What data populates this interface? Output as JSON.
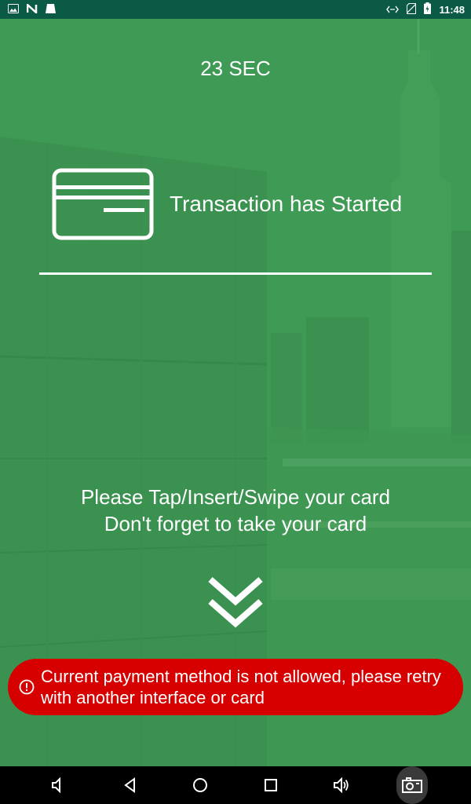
{
  "status_bar": {
    "time": "11:48",
    "left_icons": [
      "image-icon",
      "n-app-icon",
      "notification-icon"
    ],
    "right_icons": [
      "data-sync-icon",
      "no-sim-icon",
      "battery-charging-icon"
    ]
  },
  "screen": {
    "timer": "23 SEC",
    "transaction_title": "Transaction has Started",
    "instruction_line1": "Please Tap/Insert/Swipe your card",
    "instruction_line2": "Don't forget to take your card",
    "error_message": "Current payment method is not allowed, please retry with another interface or card",
    "colors": {
      "background_green": "#3f9a55",
      "status_bar": "#0b5a45",
      "error_red": "#d60000"
    }
  },
  "nav_bar": {
    "buttons": [
      "volume-down-icon",
      "back-icon",
      "home-icon",
      "recents-icon",
      "volume-up-icon",
      "screenshot-icon"
    ]
  }
}
